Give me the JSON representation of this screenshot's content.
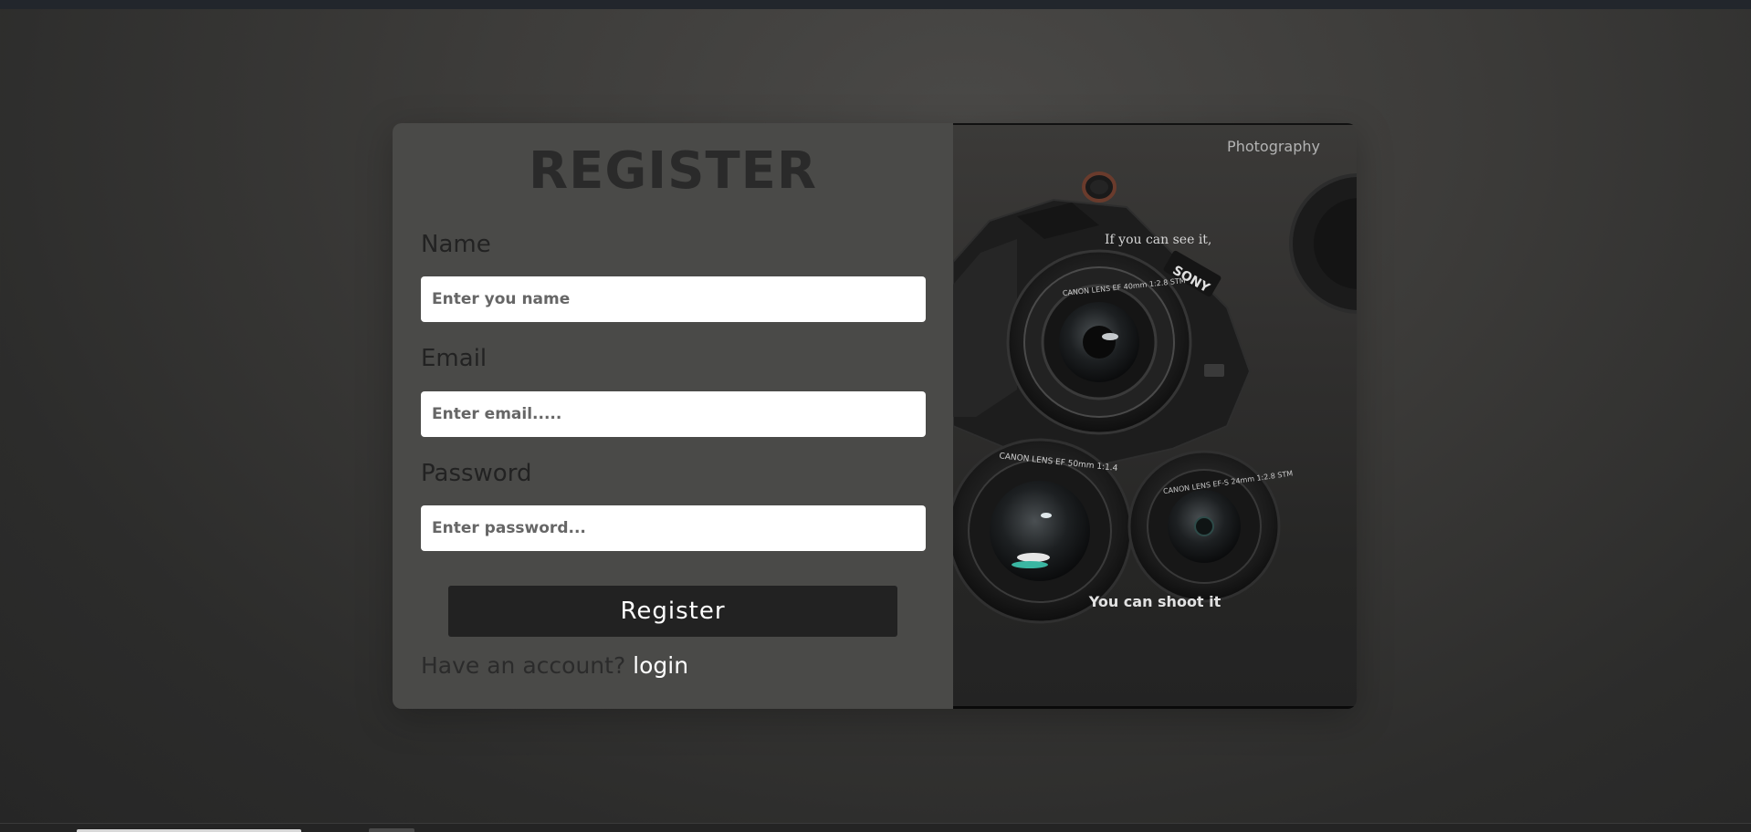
{
  "form": {
    "title": "REGISTER",
    "name_label": "Name",
    "name_placeholder": "Enter you name",
    "email_label": "Email",
    "email_placeholder": "Enter email.....",
    "password_label": "Password",
    "password_placeholder": "Enter password...",
    "register_button": "Register",
    "account_prompt": "Have an account?",
    "login_link": "login"
  },
  "photo": {
    "tag": "Photography",
    "quote_top": "If you can see it,",
    "quote_bottom": "You can shoot it",
    "camera_brand": "SONY",
    "lens_text_main": "CANON LENS EF 40mm 1:2.8 STM",
    "lens_text_left": "CANON LENS EF 50mm 1:1.4",
    "lens_text_right": "CANON LENS EF-S 24mm 1:2.8 STM"
  }
}
